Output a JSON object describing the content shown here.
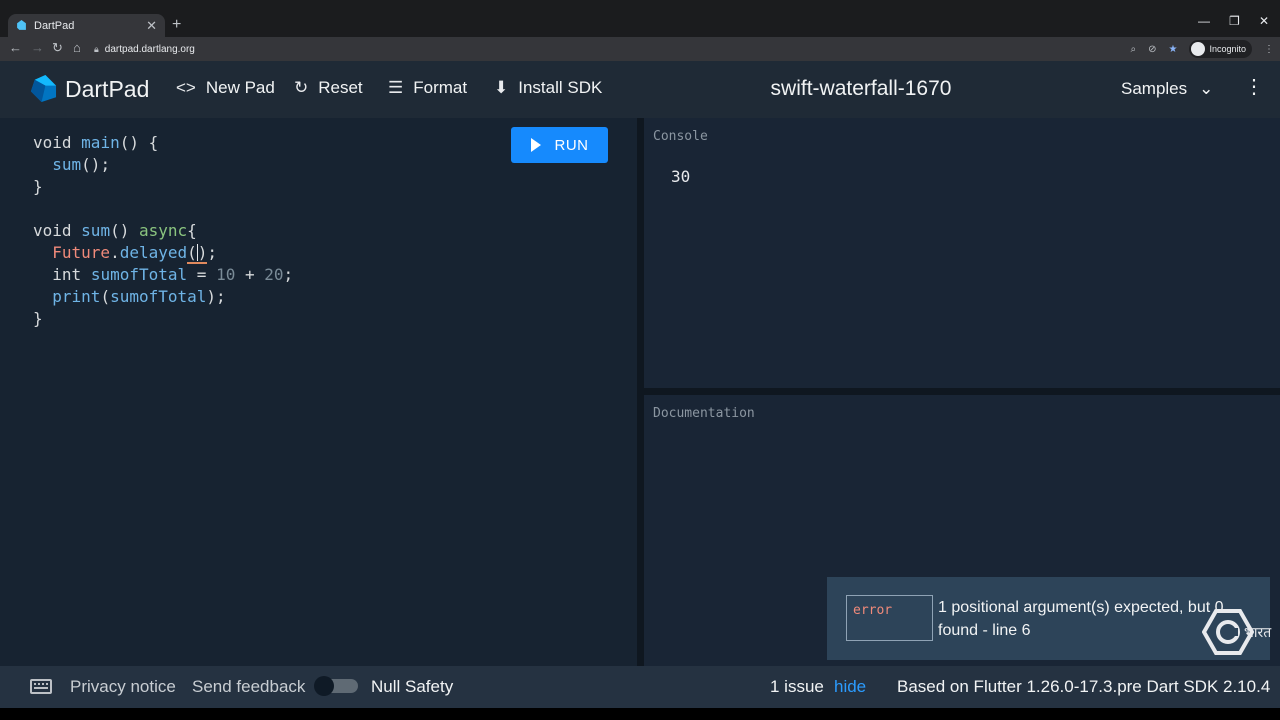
{
  "browser": {
    "tab_title": "DartPad",
    "tab_close": "✕",
    "new_tab": "+",
    "url": "dartpad.dartlang.org",
    "incognito_label": "Incognito",
    "window_controls": {
      "minimize": "—",
      "restore": "❐",
      "close": "✕"
    }
  },
  "header": {
    "brand": "DartPad",
    "new_pad": "New Pad",
    "reset": "Reset",
    "format": "Format",
    "install_sdk": "Install SDK",
    "pad_title": "swift-waterfall-1670",
    "samples": "Samples"
  },
  "editor": {
    "run_label": "RUN",
    "code": {
      "l1_void": "void",
      "l1_fn": "main",
      "l1_rest": "() {",
      "l2_fn": "sum",
      "l2_rest": "();",
      "l3": "}",
      "l5_void": "void",
      "l5_fn": "sum",
      "l5_paren": "()",
      "l5_async": "async",
      "l5_brace": "{",
      "l6_cls": "Future",
      "l6_dot": ".",
      "l6_fn": "delayed",
      "l6_open": "(",
      "l6_close": ")",
      "l6_semi": ";",
      "l7_kw": "int",
      "l7_var": "sumofTotal",
      "l7_eq": "=",
      "l7_a": "10",
      "l7_plus": "+",
      "l7_b": "20",
      "l7_semi": ";",
      "l8_fn": "print",
      "l8_open": "(",
      "l8_var": "sumofTotal",
      "l8_close": ");",
      "l9": "}"
    }
  },
  "console": {
    "label": "Console",
    "output": "30"
  },
  "documentation": {
    "label": "Documentation"
  },
  "issue_popup": {
    "severity": "error",
    "message": "1 positional argument(s) expected, but 0 found - line 6"
  },
  "watermark_text": "भारत",
  "footer": {
    "privacy": "Privacy notice",
    "feedback": "Send feedback",
    "null_safety": "Null Safety",
    "null_safety_enabled": false,
    "issues": "1 issue",
    "hide": "hide",
    "sdk_info": "Based on Flutter 1.26.0-17.3.pre Dart SDK 2.10.4"
  },
  "colors": {
    "editor_bg": "#172331",
    "header_bg": "#1f2a36",
    "run_button": "#168afd",
    "link_blue": "#2b9cff",
    "error_red": "#f08a7a"
  }
}
